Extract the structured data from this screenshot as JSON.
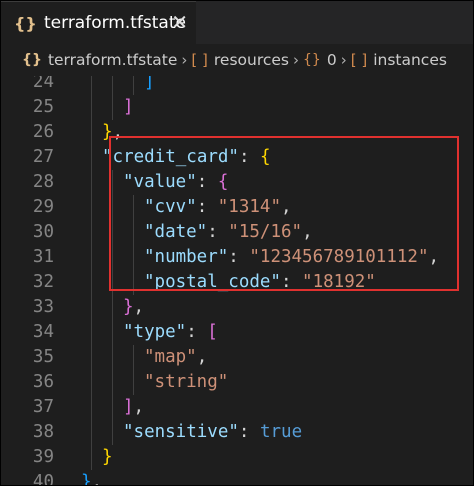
{
  "tab": {
    "icon": "{}",
    "label": "terraform.tfstate",
    "close": "✕"
  },
  "breadcrumb": {
    "file": "terraform.tfstate",
    "resources": "resources",
    "index": "0",
    "instances": "instances",
    "sep": "›",
    "brace_icon": "{}",
    "bracket_icon": "[ ]"
  },
  "lines": [
    {
      "n": "24",
      "indent": 3,
      "tokens": [
        [
          "b3",
          "]"
        ]
      ]
    },
    {
      "n": "25",
      "indent": 2,
      "tokens": [
        [
          "b2",
          "]"
        ]
      ]
    },
    {
      "n": "26",
      "indent": 1,
      "tokens": [
        [
          "b1",
          "}"
        ],
        [
          "p",
          ","
        ]
      ]
    },
    {
      "n": "27",
      "indent": 1,
      "tokens": [
        [
          "k",
          "\"credit_card\""
        ],
        [
          "p",
          ": "
        ],
        [
          "b1",
          "{"
        ]
      ]
    },
    {
      "n": "28",
      "indent": 2,
      "tokens": [
        [
          "k",
          "\"value\""
        ],
        [
          "p",
          ": "
        ],
        [
          "b2",
          "{"
        ]
      ]
    },
    {
      "n": "29",
      "indent": 3,
      "tokens": [
        [
          "k",
          "\"cvv\""
        ],
        [
          "p",
          ": "
        ],
        [
          "s",
          "\"1314\""
        ],
        [
          "p",
          ","
        ]
      ]
    },
    {
      "n": "30",
      "indent": 3,
      "tokens": [
        [
          "k",
          "\"date\""
        ],
        [
          "p",
          ": "
        ],
        [
          "s",
          "\"15/16\""
        ],
        [
          "p",
          ","
        ]
      ]
    },
    {
      "n": "31",
      "indent": 3,
      "tokens": [
        [
          "k",
          "\"number\""
        ],
        [
          "p",
          ": "
        ],
        [
          "s",
          "\"123456789101112\""
        ],
        [
          "p",
          ","
        ]
      ]
    },
    {
      "n": "32",
      "indent": 3,
      "tokens": [
        [
          "k",
          "\"postal_code\""
        ],
        [
          "p",
          ": "
        ],
        [
          "s",
          "\"18192\""
        ]
      ]
    },
    {
      "n": "33",
      "indent": 2,
      "tokens": [
        [
          "b2",
          "}"
        ],
        [
          "p",
          ","
        ]
      ]
    },
    {
      "n": "34",
      "indent": 2,
      "tokens": [
        [
          "k",
          "\"type\""
        ],
        [
          "p",
          ": "
        ],
        [
          "b2",
          "["
        ]
      ]
    },
    {
      "n": "35",
      "indent": 3,
      "tokens": [
        [
          "s",
          "\"map\""
        ],
        [
          "p",
          ","
        ]
      ]
    },
    {
      "n": "36",
      "indent": 3,
      "tokens": [
        [
          "s",
          "\"string\""
        ]
      ]
    },
    {
      "n": "37",
      "indent": 2,
      "tokens": [
        [
          "b2",
          "]"
        ],
        [
          "p",
          ","
        ]
      ]
    },
    {
      "n": "38",
      "indent": 2,
      "tokens": [
        [
          "k",
          "\"sensitive\""
        ],
        [
          "p",
          ": "
        ],
        [
          "kw",
          "true"
        ]
      ]
    },
    {
      "n": "39",
      "indent": 1,
      "tokens": [
        [
          "b1",
          "}"
        ]
      ]
    },
    {
      "n": "40",
      "indent": 0,
      "tokens": [
        [
          "b3",
          "}"
        ],
        [
          "p",
          ","
        ]
      ]
    }
  ]
}
